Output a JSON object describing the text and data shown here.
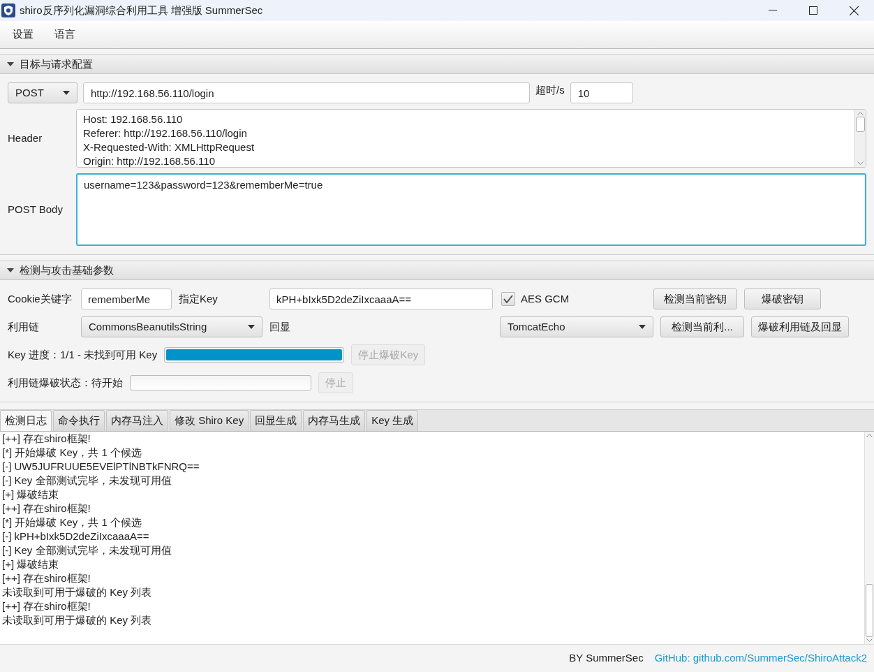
{
  "window": {
    "title": "shiro反序列化漏洞综合利用工具 增强版 SummerSec"
  },
  "menu": [
    "设置",
    "语言"
  ],
  "target_section": {
    "title": "目标与请求配置",
    "expanded": true,
    "method": "POST",
    "url": "http://192.168.56.110/login",
    "timeout_label": "超时/s",
    "timeout": "10",
    "header_label": "Header",
    "header_lines": [
      "Host: 192.168.56.110",
      "Referer: http://192.168.56.110/login",
      "X-Requested-With: XMLHttpRequest",
      "Origin: http://192.168.56.110"
    ],
    "body_label": "POST Body",
    "body": "username=123&password=123&rememberMe=true"
  },
  "attack_section": {
    "title": "检测与攻击基础参数",
    "expanded": true,
    "cookie_label": "Cookie关键字",
    "cookie": "rememberMe",
    "key_label": "指定Key",
    "key": "kPH+bIxk5D2deZiIxcaaaA==",
    "aes_gcm": {
      "label": "AES GCM",
      "checked": true
    },
    "buttons_row1": [
      "检测当前密钥",
      "爆破密钥"
    ],
    "chain_label": "利用链",
    "chain": "CommonsBeanutilsString",
    "echo_label": "回显",
    "echo": "TomcatEcho",
    "buttons_row2": [
      "检测当前利...",
      "爆破利用链及回显"
    ],
    "key_progress": {
      "label": "Key 进度：1/1 - 未找到可用 Key",
      "level": 1,
      "button": "停止爆破Key",
      "disabled": true
    },
    "chain_progress": {
      "label": "利用链爆破状态：待开始",
      "level": 0,
      "button": "停止",
      "disabled": true
    }
  },
  "tabs": [
    {
      "label": "检测日志",
      "selected": true
    },
    {
      "label": "命令执行",
      "selected": false
    },
    {
      "label": "内存马注入",
      "selected": false
    },
    {
      "label": "修改 Shiro Key",
      "selected": false
    },
    {
      "label": "回显生成",
      "selected": false
    },
    {
      "label": "内存马生成",
      "selected": false
    },
    {
      "label": "Key 生成",
      "selected": false
    }
  ],
  "log": [
    "[++] 存在shiro框架!",
    "[*] 开始爆破 Key，共 1 个候选",
    "[-] UW5JUFRUUE5EVElPTlNBTkFNRQ==",
    "[-] Key 全部测试完毕，未发现可用值",
    "[+] 爆破结束",
    "[++] 存在shiro框架!",
    "[*] 开始爆破 Key，共 1 个候选",
    "[-] kPH+bIxk5D2deZiIxcaaaA==",
    "[-] Key 全部测试完毕，未发现可用值",
    "[+] 爆破结束",
    "[++] 存在shiro框架!",
    "未读取到可用于爆破的 Key 列表",
    "[++] 存在shiro框架!",
    "未读取到可用于爆破的 Key 列表"
  ],
  "footer": {
    "author": "BY SummerSec",
    "link": "GitHub: github.com/SummerSec/ShiroAttack2"
  }
}
